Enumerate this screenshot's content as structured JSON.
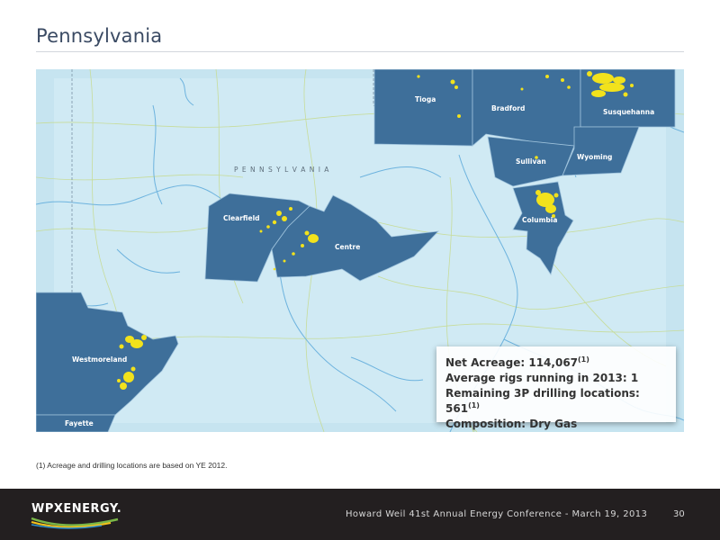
{
  "slide": {
    "title": "Pennsylvania"
  },
  "map": {
    "state_label": "P E N N S Y L V A N I A",
    "counties": [
      "Tioga",
      "Bradford",
      "Susquehanna",
      "Sullivan",
      "Wyoming",
      "Columbia",
      "Clearfield",
      "Centre",
      "Westmoreland",
      "Fayette"
    ],
    "colors": {
      "background": "#cde9f3",
      "county_fill": "#3e6f9a",
      "acreage": "#f2e21c",
      "rivers": "#6db3de",
      "roads": "#c7dc9a"
    }
  },
  "info_box": {
    "net_acreage_label": "Net Acreage: 114,067",
    "net_acreage_note": "(1)",
    "rigs_line": "Average rigs running in 2013: 1",
    "locations_label": "Remaining 3P drilling locations: 561",
    "locations_note": "(1)",
    "composition_line": "Composition: Dry Gas"
  },
  "footnote": "(1) Acreage and drilling locations are based on YE 2012.",
  "footer": {
    "logo_text": "WPXENERGY.",
    "event_text": "Howard Weil 41st Annual Energy Conference - March 19, 2013",
    "page_number": "30"
  }
}
